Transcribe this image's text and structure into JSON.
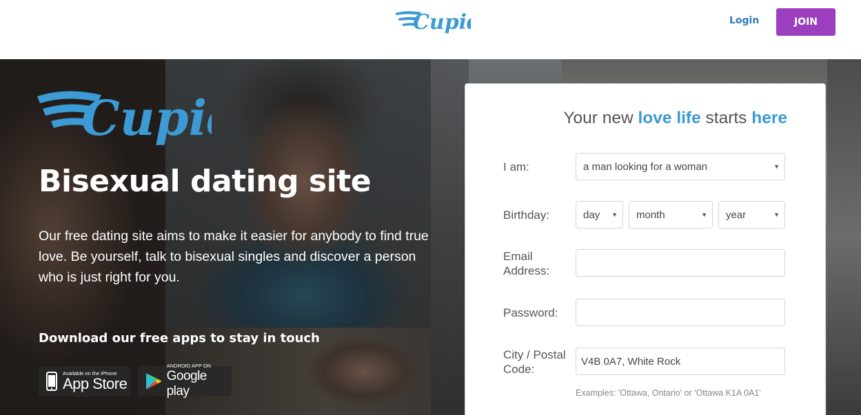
{
  "header": {
    "logo_text": "Cupid",
    "login_label": "Login",
    "join_label": "JOIN"
  },
  "hero": {
    "logo_text": "Cupid",
    "title": "Bisexual dating site",
    "description": "Our free dating site aims to make it easier for anybody to find true love. Be yourself, talk to bisexual singles and discover a person who is just right for you.",
    "apps_heading": "Download our free apps to stay in touch",
    "appstore_small": "Available on the iPhone",
    "appstore_big": "App Store",
    "googleplay_small": "ANDROID APP ON",
    "googleplay_big": "Google play"
  },
  "form": {
    "heading_part1": "Your new ",
    "heading_hl1": "love life",
    "heading_part2": " starts ",
    "heading_hl2": "here",
    "iam_label": "I am:",
    "iam_value": "a man looking for a woman",
    "birthday_label": "Birthday:",
    "day_value": "day",
    "month_value": "month",
    "year_value": "year",
    "email_label": "Email Address:",
    "email_value": "",
    "password_label": "Password:",
    "password_value": "",
    "city_label": "City / Postal Code:",
    "city_value": "V4B 0A7, White Rock",
    "city_hint": "Examples: 'Ottawa, Ontario' or 'Ottawa K1A 0A1'"
  },
  "colors": {
    "brand_blue": "#3c9ad4",
    "join_purple": "#9b3fbf",
    "login_blue": "#2e7bbf"
  },
  "icons": [
    "cupid-wing-logo",
    "apple-icon",
    "google-play-icon",
    "chevron-down-icon"
  ]
}
